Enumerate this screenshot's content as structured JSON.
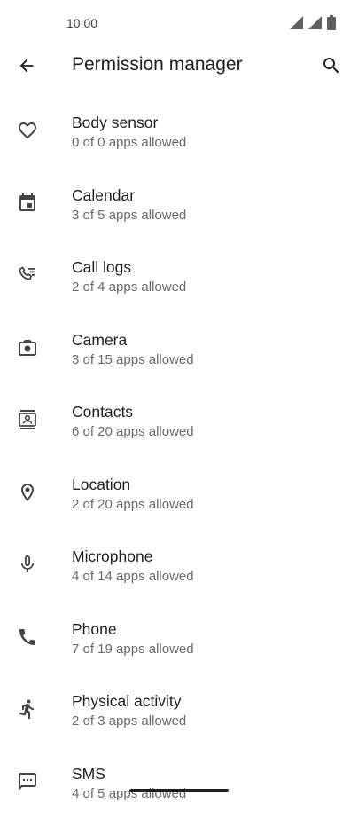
{
  "status_bar": {
    "time": "10.00",
    "icons": [
      "signal-icon",
      "signal-icon",
      "battery-icon"
    ]
  },
  "app_bar": {
    "title": "Permission manager",
    "back_icon": "arrow-back-icon",
    "search_icon": "search-icon"
  },
  "permissions": [
    {
      "icon": "heart-outline-icon",
      "title": "Body sensor",
      "subtitle": "0 of 0 apps allowed"
    },
    {
      "icon": "calendar-icon",
      "title": "Calendar",
      "subtitle": "3 of 5 apps allowed"
    },
    {
      "icon": "call-log-icon",
      "title": "Call logs",
      "subtitle": "2 of 4 apps allowed"
    },
    {
      "icon": "camera-icon",
      "title": "Camera",
      "subtitle": "3 of 15 apps allowed"
    },
    {
      "icon": "contacts-icon",
      "title": "Contacts",
      "subtitle": "6 of 20 apps allowed"
    },
    {
      "icon": "location-pin-icon",
      "title": "Location",
      "subtitle": "2 of 20 apps allowed"
    },
    {
      "icon": "microphone-icon",
      "title": "Microphone",
      "subtitle": "4 of 14 apps allowed"
    },
    {
      "icon": "phone-icon",
      "title": "Phone",
      "subtitle": "7 of 19 apps allowed"
    },
    {
      "icon": "physical-activity-icon",
      "title": "Physical activity",
      "subtitle": "2 of 3 apps allowed"
    },
    {
      "icon": "sms-icon",
      "title": "SMS",
      "subtitle": "4 of 5 apps allowed"
    }
  ]
}
